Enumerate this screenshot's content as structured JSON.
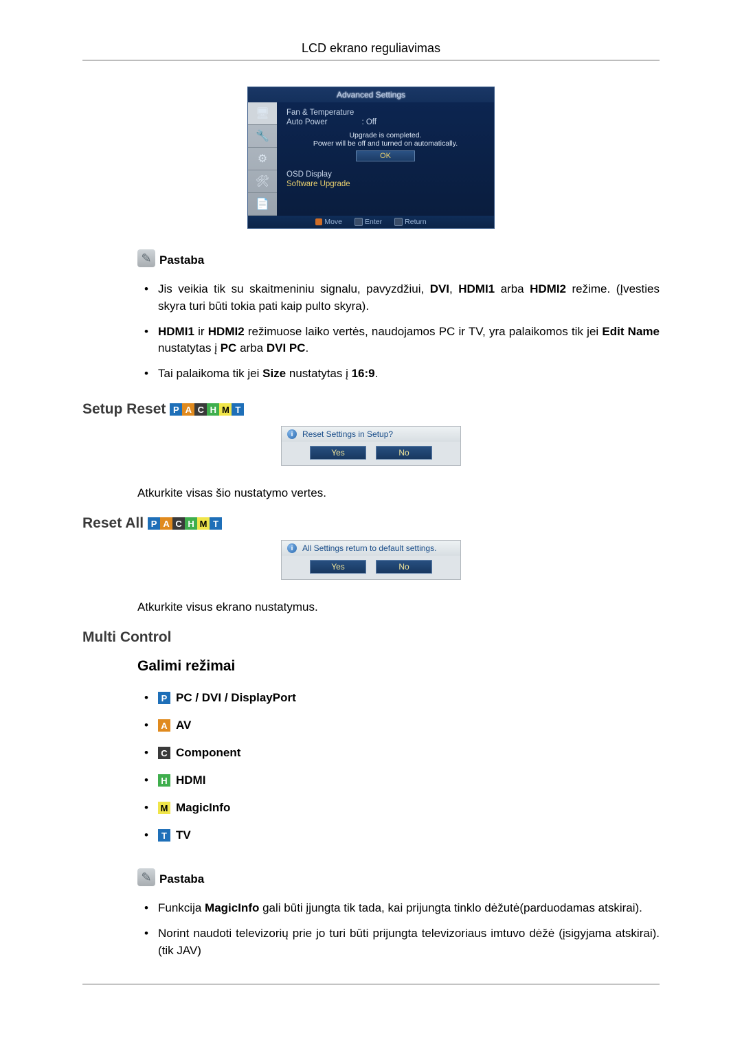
{
  "header": {
    "title": "LCD ekrano reguliavimas"
  },
  "osd1": {
    "title": "Advanced Settings",
    "row_fan": "Fan & Temperature",
    "row_auto_power": "Auto Power",
    "row_auto_power_val": ": Off",
    "msg_line1": "Upgrade is completed.",
    "msg_line2": "Power will be off and turned on automatically.",
    "ok": "OK",
    "row_osd": "OSD Display",
    "row_upgrade": "Software Upgrade",
    "footer_move": "Move",
    "footer_enter": "Enter",
    "footer_return": "Return"
  },
  "note1": {
    "label": "Pastaba",
    "items": {
      "b0": {
        "pre": "Jis veikia tik su skaitmeniniu signalu, pavyzdžiui, ",
        "dvi": "DVI",
        "c1": ", ",
        "h1": "HDMI1",
        "c2": " arba ",
        "h2": "HDMI2",
        "post": " režime. (Įvesties skyra turi būti tokia pati kaip pulto skyra)."
      },
      "b1": {
        "h1": "HDMI1",
        "ir": " ir ",
        "h2": "HDMI2",
        "mid": " režimuose laiko vertės, naudojamos PC ir TV, yra palaikomos tik jei ",
        "edit": "Edit Name",
        "set": " nustatytas į ",
        "pc": "PC",
        "or": " arba ",
        "dvipc": "DVI PC",
        "dot": "."
      },
      "b2": {
        "pre": "Tai palaikoma tik jei ",
        "size": "Size",
        "mid": " nustatytas į ",
        "ratio": "16:9",
        "dot": "."
      }
    }
  },
  "setup_reset": {
    "heading": "Setup Reset",
    "dialog_title": "Reset Settings in Setup?",
    "yes": "Yes",
    "no": "No",
    "desc": "Atkurkite visas šio nustatymo vertes."
  },
  "reset_all": {
    "heading": "Reset All",
    "dialog_title": "All Settings return to default settings.",
    "yes": "Yes",
    "no": "No",
    "desc": "Atkurkite visus ekrano nustatymus."
  },
  "multi_control": {
    "heading": "Multi Control",
    "sub": "Galimi režimai",
    "modes": {
      "p": "PC / DVI / DisplayPort",
      "a": "AV",
      "c": "Component",
      "h": "HDMI",
      "m": "MagicInfo",
      "t": "TV"
    }
  },
  "note2": {
    "label": "Pastaba",
    "items": {
      "b0": {
        "pre": "Funkcija ",
        "mi": "MagicInfo",
        "post": " gali būti įjungta tik tada, kai prijungta tinklo dėžutė(parduodamas atskirai)."
      },
      "b1": {
        "text": "Norint naudoti televizorių prie jo turi būti prijungta televizoriaus imtuvo dėžė (įsigyjama atskirai). (tik JAV)"
      }
    }
  },
  "chips": {
    "P": "P",
    "A": "A",
    "C": "C",
    "H": "H",
    "M": "M",
    "T": "T"
  }
}
